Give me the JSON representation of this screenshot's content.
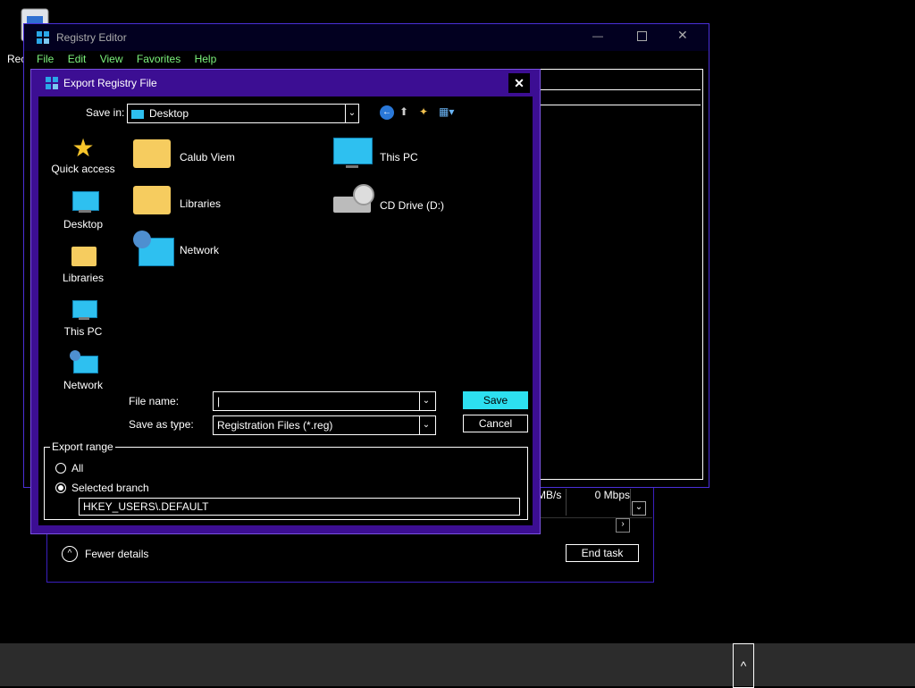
{
  "desktop": {
    "icon_label": "Rec"
  },
  "registry": {
    "title": "Registry Editor",
    "menu": [
      "File",
      "Edit",
      "View",
      "Favorites",
      "Help"
    ]
  },
  "task_manager": {
    "rate_left": "MB/s",
    "rate_right": "0 Mbps",
    "fewer_details": "Fewer details",
    "end_task": "End task"
  },
  "dialog": {
    "title": "Export Registry File",
    "save_in_label": "Save in:",
    "save_in_value": "Desktop",
    "nav": [
      "Quick access",
      "Desktop",
      "Libraries",
      "This PC",
      "Network"
    ],
    "items": [
      "Calub Viem",
      "This PC",
      "Libraries",
      "CD Drive (D:)",
      "Network"
    ],
    "file_name_label": "File name:",
    "file_name_value": "|",
    "save_type_label": "Save as type:",
    "save_type_value": "Registration Files (*.reg)",
    "save_button": "Save",
    "cancel_button": "Cancel",
    "export_range_label": "Export range",
    "all_label": "All",
    "selected_branch_label": "Selected branch",
    "branch_value": "HKEY_USERS\\.DEFAULT"
  },
  "colors": {
    "accent": "#2de0f0",
    "dialog_frame": "#3c0e93",
    "menu_text": "#7cf27c"
  }
}
